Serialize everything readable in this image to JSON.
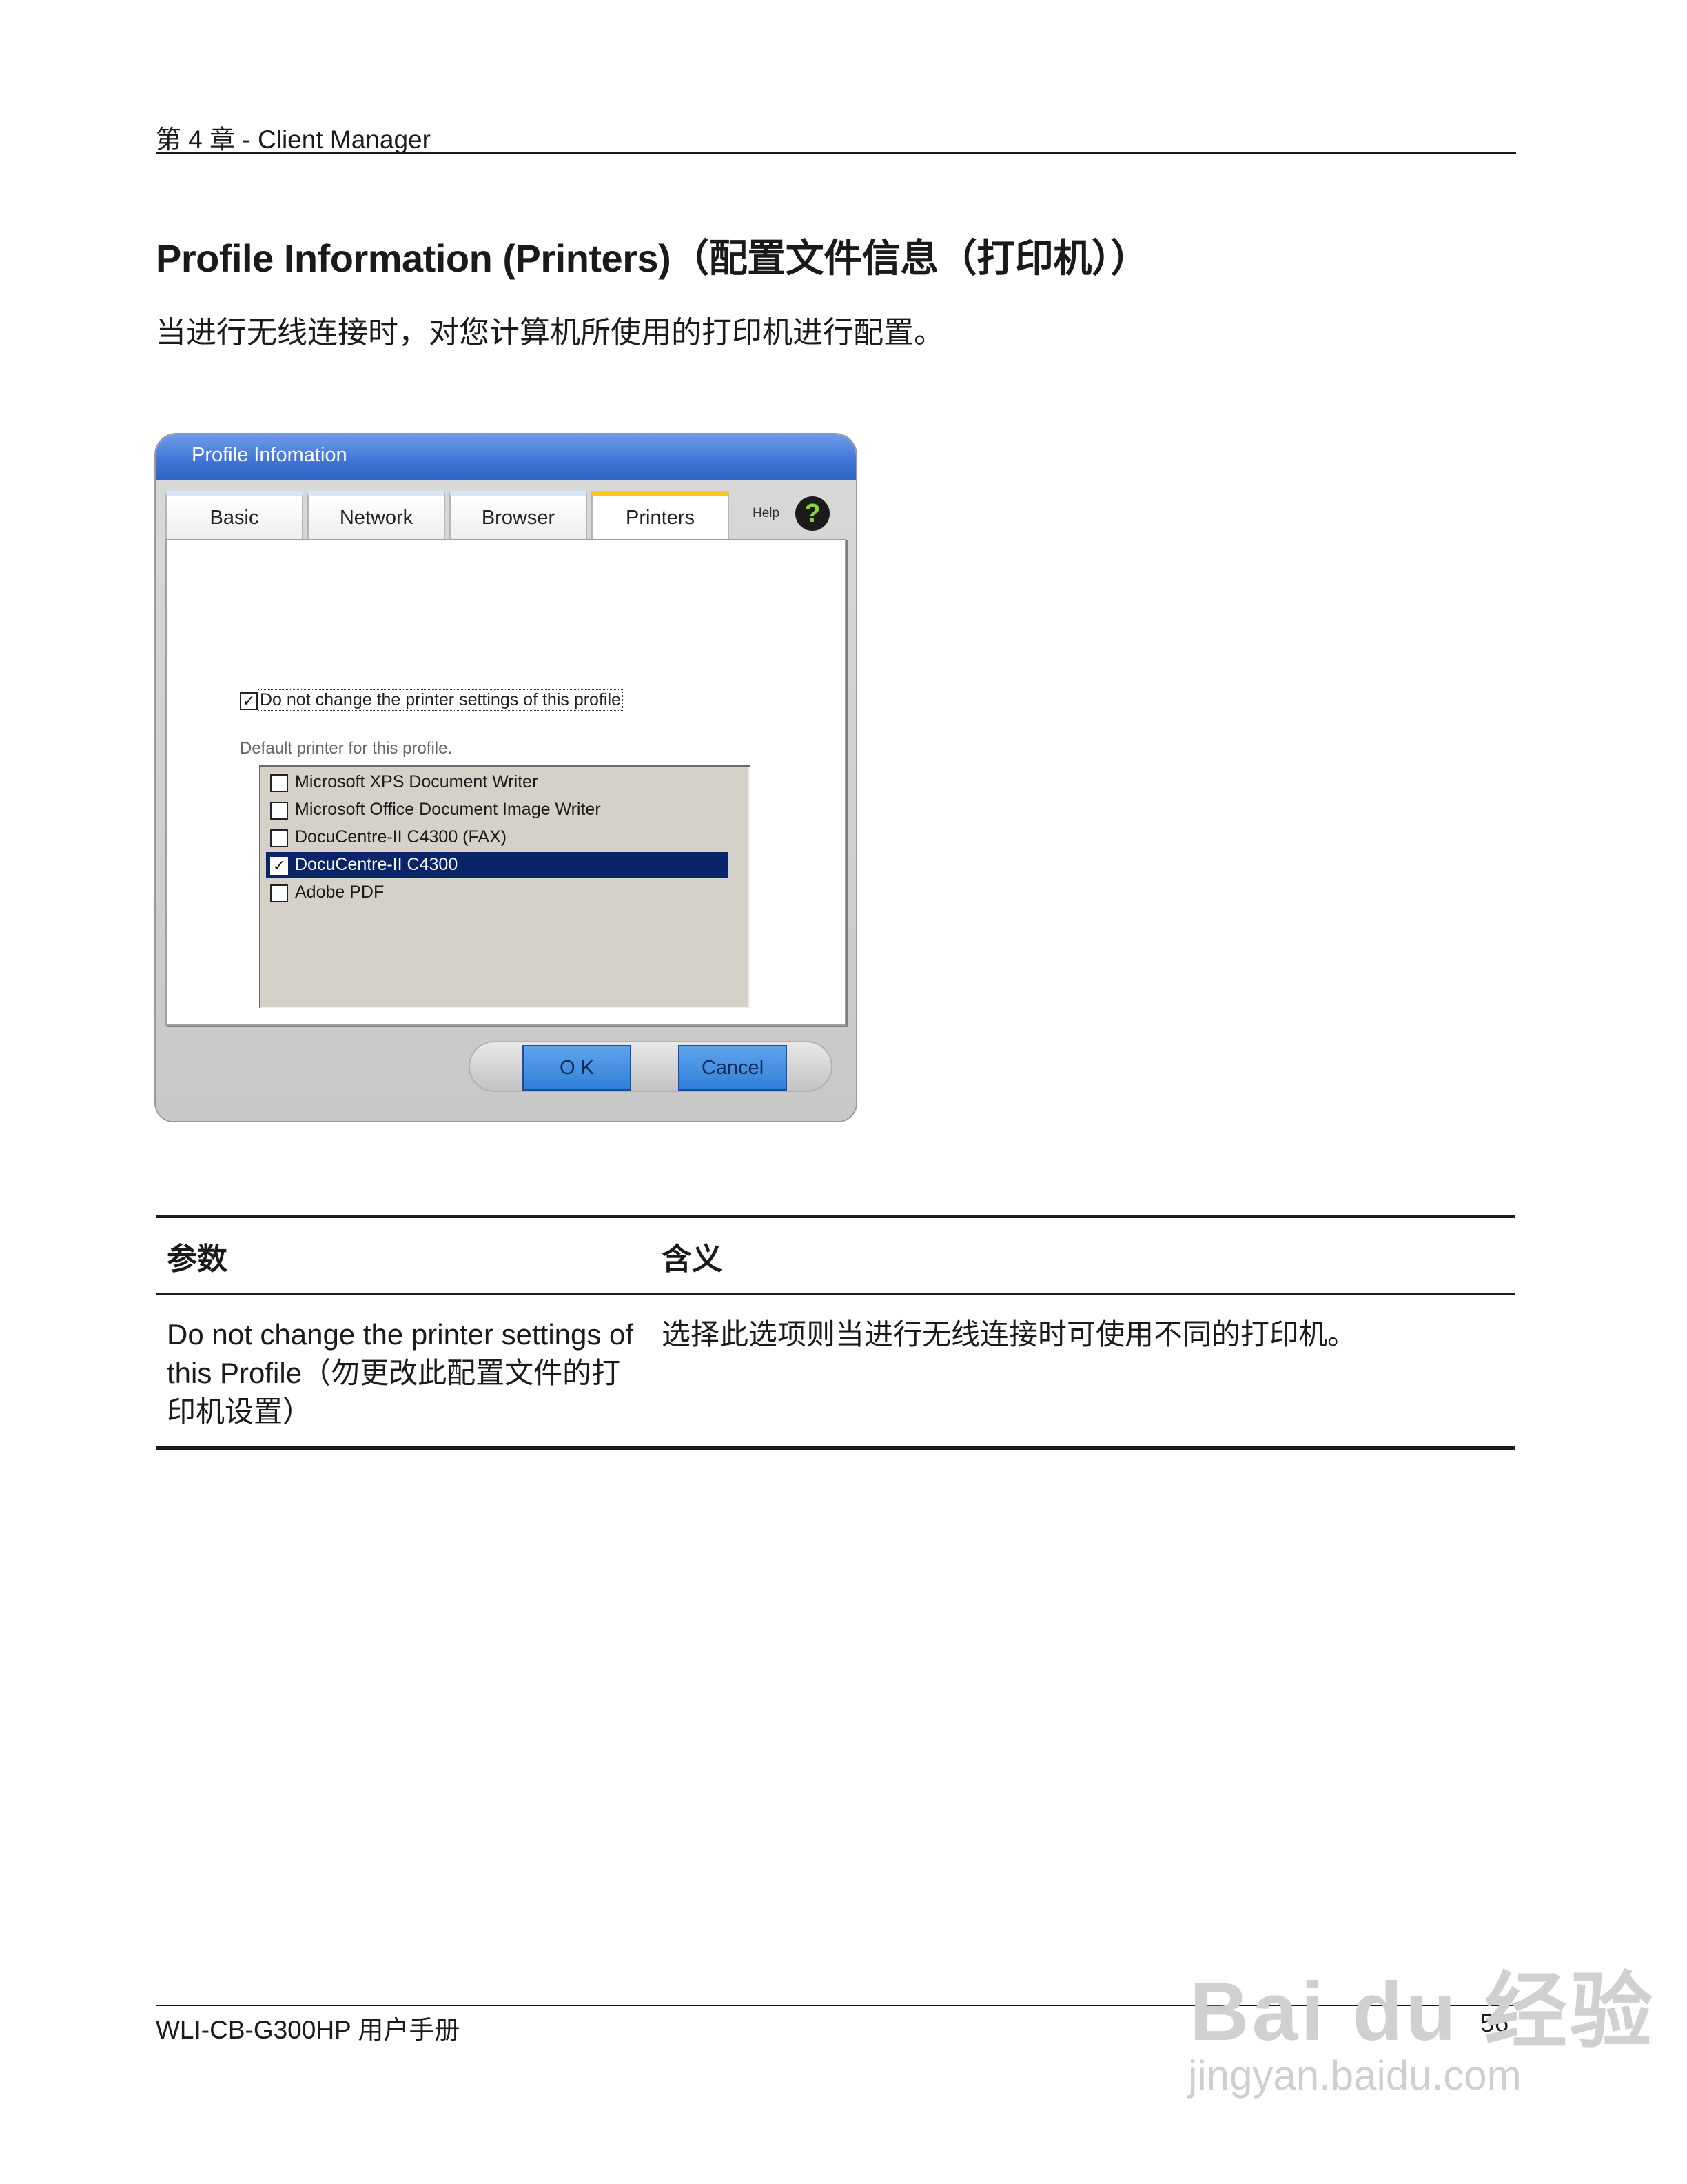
{
  "header": {
    "chapter": "第 4 章 - Client Manager"
  },
  "title": "Profile Information (Printers)（配置文件信息（打印机））",
  "intro": "当进行无线连接时，对您计算机所使用的打印机进行配置。",
  "dialog": {
    "title": "Profile Infomation",
    "tabs": [
      {
        "label": "Basic",
        "active": false
      },
      {
        "label": "Network",
        "active": false
      },
      {
        "label": "Browser",
        "active": false
      },
      {
        "label": "Printers",
        "active": true
      }
    ],
    "help_label": "Help",
    "help_icon": "question-mark-icon",
    "option": {
      "label": "Do not change the printer settings of this profile",
      "checked": true
    },
    "default_label": "Default printer for this profile.",
    "printers": [
      {
        "name": "Microsoft XPS Document Writer",
        "checked": false,
        "selected": false
      },
      {
        "name": "Microsoft Office Document Image Writer",
        "checked": false,
        "selected": false
      },
      {
        "name": "DocuCentre-II C4300 (FAX)",
        "checked": false,
        "selected": false
      },
      {
        "name": "DocuCentre-II C4300",
        "checked": true,
        "selected": true
      },
      {
        "name": "Adobe PDF",
        "checked": false,
        "selected": false
      }
    ],
    "ok_label": "O K",
    "cancel_label": "Cancel"
  },
  "table": {
    "headers": [
      "参数",
      "含义"
    ],
    "rows": [
      {
        "param_lines": [
          "Do not change the printer settings of",
          "this Profile（勿更改此配置文件的打",
          "印机设置）"
        ],
        "meaning": "选择此选项则当进行无线连接时可使用不同的打印机。"
      }
    ]
  },
  "footer": {
    "manual": "WLI-CB-G300HP 用户手册",
    "page": "56"
  },
  "watermark": {
    "logo_text": "Bai du 经验",
    "url": "jingyan.baidu.com"
  },
  "colors": {
    "titlebar": "#3f74d6",
    "selection": "#0a246a",
    "active_tab": "#ffc81a",
    "help": "#8bd43b"
  }
}
